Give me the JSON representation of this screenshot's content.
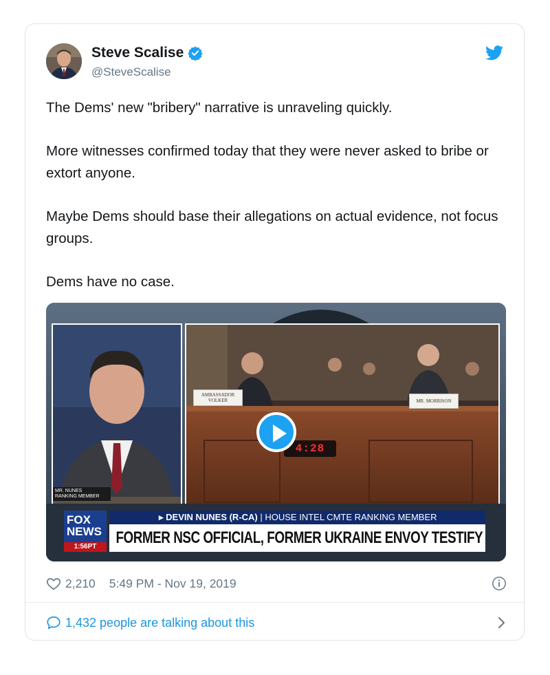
{
  "tweet": {
    "author": {
      "name": "Steve Scalise",
      "handle": "@SteveScalise",
      "verified": true
    },
    "paragraphs": [
      "The Dems' new \"bribery\" narrative is unraveling quickly.",
      "More witnesses confirmed today that they were never asked to bribe or extort anyone.",
      "Maybe Dems should base their allegations on actual evidence, not focus groups.",
      "Dems have no case."
    ],
    "media": {
      "nunes_label": "MR. NUNES",
      "nunes_sublabel": "RANKING MEMBER",
      "nameplate_left": "AMBASSADOR VOLKER",
      "nameplate_right": "MR. MORRISON",
      "clock": "4:28",
      "fox_logo": "FOX NEWS",
      "fox_time": "1:56PT",
      "lower_bar": "▸ DEVIN NUNES (R-CA)",
      "lower_bar_detail": "| HOUSE INTEL CMTE RANKING MEMBER",
      "headline": "FORMER NSC OFFICIAL, FORMER UKRAINE ENVOY TESTIFY"
    },
    "likes": "2,210",
    "timestamp": "5:49 PM - Nov 19, 2019",
    "conversation": "1,432 people are talking about this"
  },
  "icons": {
    "verified": "verified-badge-icon",
    "brand": "twitter-bird-icon",
    "like": "heart-icon",
    "info": "info-icon",
    "reply": "speech-bubble-icon",
    "more": "chevron-right-icon",
    "play": "play-icon"
  },
  "colors": {
    "accent": "#1da1f2",
    "link": "#1b95e0",
    "text": "#14171a",
    "muted": "#657786",
    "border": "#dfe3e6"
  }
}
